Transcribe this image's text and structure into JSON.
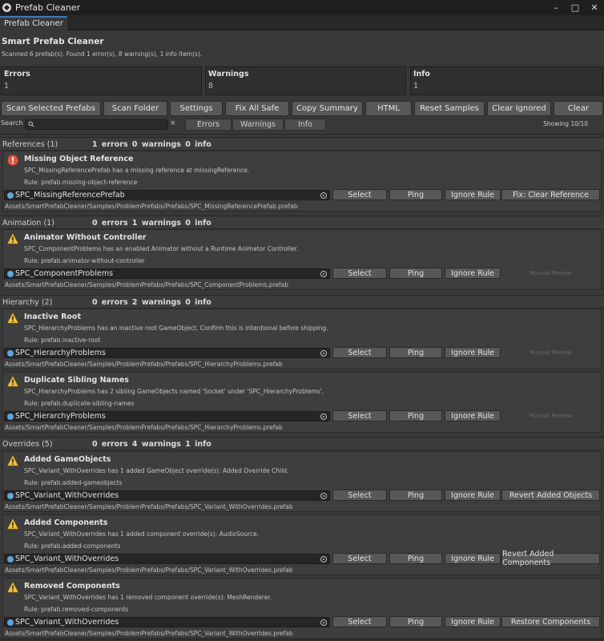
{
  "window": {
    "title": "Prefab Cleaner",
    "tab": "Prefab Cleaner",
    "minimize": "–",
    "maximize": "□",
    "close": "✕"
  },
  "header": {
    "title": "Smart Prefab Cleaner",
    "status": "Scanned 6 prefab(s). Found 1 error(s), 8 warning(s), 1 info item(s)."
  },
  "summary": [
    {
      "label": "Errors",
      "value": "1"
    },
    {
      "label": "Warnings",
      "value": "8"
    },
    {
      "label": "Info",
      "value": "1"
    }
  ],
  "toolbar": [
    "Scan Selected Prefabs",
    "Scan Folder",
    "Settings",
    "Fix All Safe",
    "Copy Summary",
    "HTML",
    "Reset Samples",
    "Clear Ignored",
    "Clear"
  ],
  "search": {
    "label": "Search",
    "value": "",
    "clear": "×"
  },
  "filters": [
    "Errors",
    "Warnings",
    "Info"
  ],
  "showing": "Showing 10/10",
  "groups": [
    {
      "name": "References (1)",
      "counts": "1 errors  0 warnings  0 info"
    },
    {
      "name": "Animation (1)",
      "counts": "0 errors  1 warnings  0 info"
    },
    {
      "name": "Hierarchy (2)",
      "counts": "0 errors  2 warnings  0 info"
    },
    {
      "name": "Overrides (5)",
      "counts": "0 errors  4 warnings  1 info"
    }
  ],
  "issues": [
    {
      "severity": "error",
      "title": "Missing Object Reference",
      "message": "SPC_MissingReferencePrefab has a missing reference at missingReference.",
      "rule": "Rule: prefab.missing-object-reference",
      "object": "SPC_MissingReferencePrefab",
      "buttons": [
        "Select",
        "Ping",
        "Ignore Rule"
      ],
      "fix": "Fix: Clear Reference",
      "manual": "",
      "path": "Assets/SmartPrefabCleaner/Samples/ProblemPrefabs/Prefabs/SPC_MissingReferencePrefab.prefab"
    },
    {
      "severity": "warning",
      "title": "Animator Without Controller",
      "message": "SPC_ComponentProblems has an enabled Animator without a Runtime Animator Controller.",
      "rule": "Rule: prefab.animator-without-controller",
      "object": "SPC_ComponentProblems",
      "buttons": [
        "Select",
        "Ping",
        "Ignore Rule"
      ],
      "fix": "",
      "manual": "Manual Review",
      "path": "Assets/SmartPrefabCleaner/Samples/ProblemPrefabs/Prefabs/SPC_ComponentProblems.prefab"
    },
    {
      "severity": "warning",
      "title": "Inactive Root",
      "message": "SPC_HierarchyProblems has an inactive root GameObject. Confirm this is intentional before shipping.",
      "rule": "Rule: prefab.inactive-root",
      "object": "SPC_HierarchyProblems",
      "buttons": [
        "Select",
        "Ping",
        "Ignore Rule"
      ],
      "fix": "",
      "manual": "Manual Review",
      "path": "Assets/SmartPrefabCleaner/Samples/ProblemPrefabs/Prefabs/SPC_HierarchyProblems.prefab"
    },
    {
      "severity": "warning",
      "title": "Duplicate Sibling Names",
      "message": "SPC_HierarchyProblems has 2 sibling GameObjects named 'Socket' under 'SPC_HierarchyProblems'.",
      "rule": "Rule: prefab.duplicate-sibling-names",
      "object": "SPC_HierarchyProblems",
      "buttons": [
        "Select",
        "Ping",
        "Ignore Rule"
      ],
      "fix": "",
      "manual": "Manual Review",
      "path": "Assets/SmartPrefabCleaner/Samples/ProblemPrefabs/Prefabs/SPC_HierarchyProblems.prefab"
    },
    {
      "severity": "warning",
      "title": "Added GameObjects",
      "message": "SPC_Variant_WithOverrides has 1 added GameObject override(s): Added Override Child.",
      "rule": "Rule: prefab.added-gameobjects",
      "object": "SPC_Variant_WithOverrides",
      "buttons": [
        "Select",
        "Ping",
        "Ignore Rule"
      ],
      "fix": "Revert Added Objects",
      "manual": "",
      "path": "Assets/SmartPrefabCleaner/Samples/ProblemPrefabs/Prefabs/SPC_Variant_WithOverrides.prefab"
    },
    {
      "severity": "warning",
      "title": "Added Components",
      "message": "SPC_Variant_WithOverrides has 1 added component override(s): AudioSource.",
      "rule": "Rule: prefab.added-components",
      "object": "SPC_Variant_WithOverrides",
      "buttons": [
        "Select",
        "Ping",
        "Ignore Rule"
      ],
      "fix": "Revert Added Components",
      "manual": "",
      "path": "Assets/SmartPrefabCleaner/Samples/ProblemPrefabs/Prefabs/SPC_Variant_WithOverrides.prefab"
    },
    {
      "severity": "warning",
      "title": "Removed Components",
      "message": "SPC_Variant_WithOverrides has 1 removed component override(s): MeshRenderer.",
      "rule": "Rule: prefab.removed-components",
      "object": "SPC_Variant_WithOverrides",
      "buttons": [
        "Select",
        "Ping",
        "Ignore Rule"
      ],
      "fix": "Restore Components",
      "manual": "",
      "path": "Assets/SmartPrefabCleaner/Samples/ProblemPrefabs/Prefabs/SPC_Variant_WithOverrides.prefab"
    }
  ],
  "colors": {
    "error": "#e8533d",
    "warning": "#f2c12e",
    "object_icon": "#5fa6db",
    "tab_accent": "#3a79bb"
  }
}
